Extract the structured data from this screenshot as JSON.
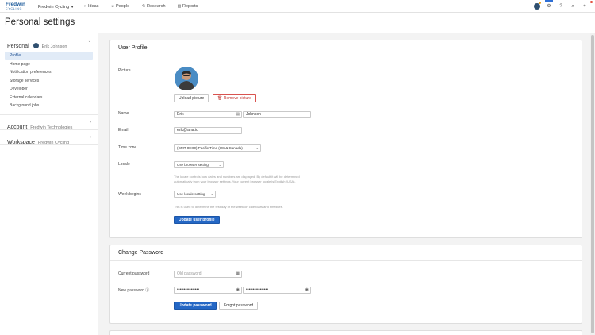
{
  "nav": {
    "logo_line1": "Fredwin",
    "logo_line2": "CYCLING",
    "workspace": "Fredwin Cycling",
    "items": [
      {
        "label": "Ideas",
        "icon": "lightbulb-icon"
      },
      {
        "label": "People",
        "icon": "person-icon"
      },
      {
        "label": "Research",
        "icon": "flask-icon"
      },
      {
        "label": "Reports",
        "icon": "chart-icon"
      }
    ]
  },
  "page": {
    "title": "Personal settings"
  },
  "sidebar": {
    "personal": {
      "title": "Personal",
      "user": "Erik Johnson"
    },
    "links": [
      "Profile",
      "Home page",
      "Notification preferences",
      "Storage services",
      "Developer",
      "External calendars",
      "Background jobs"
    ],
    "account": {
      "title": "Account",
      "sub": "Fredwin Technologies"
    },
    "workspace": {
      "title": "Workspace",
      "sub": "Fredwin Cycling"
    }
  },
  "profile": {
    "heading": "User Profile",
    "picture_label": "Picture",
    "upload_label": "Upload picture",
    "remove_label": "Remove picture",
    "name_label": "Name",
    "first_name": "Erik",
    "last_name": "Johnson",
    "email_label": "Email",
    "email": "erik@aha.io",
    "timezone_label": "Time zone",
    "timezone": "(GMT-08:00) Pacific Time (US & Canada)",
    "locale_label": "Locale",
    "locale": "Use browser setting",
    "locale_help_1": "The locale controls how dates and numbers are displayed. By default it will be determined",
    "locale_help_2": "automatically from your browser settings. Your current browser locale is English (USA).",
    "week_label": "Week begins",
    "week": "Use locale setting",
    "week_help": "This is used to determine the first day of the week on calendars and timelines.",
    "update_label": "Update user profile"
  },
  "password": {
    "heading": "Change Password",
    "current_label": "Current password",
    "old_placeholder": "Old password",
    "new_label": "New password",
    "masked": "••••••••••••••••",
    "update_label": "Update password",
    "forgot_label": "Forgot password"
  },
  "colors": {
    "primary": "#2467c5",
    "danger": "#c23a36",
    "active_bg": "#e1ebf7"
  }
}
